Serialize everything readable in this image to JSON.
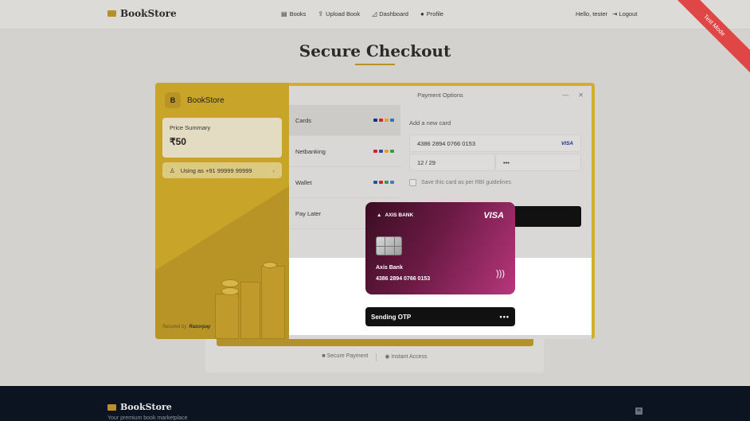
{
  "header": {
    "brand": "BookStore",
    "nav": [
      {
        "label": "Books",
        "icon": "book-icon"
      },
      {
        "label": "Upload Book",
        "icon": "upload-icon"
      },
      {
        "label": "Dashboard",
        "icon": "chart-icon"
      },
      {
        "label": "Profile",
        "icon": "user-icon"
      }
    ],
    "greeting": "Hello, tester",
    "logout": "Logout",
    "ribbon": "Test Mode"
  },
  "page": {
    "title": "Secure Checkout",
    "footnotes": [
      "Secure Payment",
      "Instant Access"
    ]
  },
  "razorpay": {
    "merchant_initial": "B",
    "merchant": "BookStore",
    "price_summary_label": "Price Summary",
    "amount": "₹50",
    "using_as": "Using as +91 99999 99999",
    "secured_by": "Secured by",
    "provider": "Razorpay",
    "panel_title": "Payment Options",
    "methods": [
      {
        "label": "Cards"
      },
      {
        "label": "Netbanking"
      },
      {
        "label": "Wallet"
      },
      {
        "label": "Pay Later"
      }
    ],
    "card_form": {
      "heading": "Add a new card",
      "card_number": "4386 2894 0766 0153",
      "network": "VISA",
      "expiry": "12 / 29",
      "cvv": "•••",
      "save_label": "Save this card as per RBI guidelines"
    }
  },
  "overlay": {
    "bank": "AXIS BANK",
    "network": "VISA",
    "holder": "Axis Bank",
    "card_number": "4386 2894 0766 0153",
    "status": "Sending OTP",
    "status_dots": "•••"
  },
  "footer": {
    "brand": "BookStore",
    "tagline": "Your premium book marketplace"
  }
}
